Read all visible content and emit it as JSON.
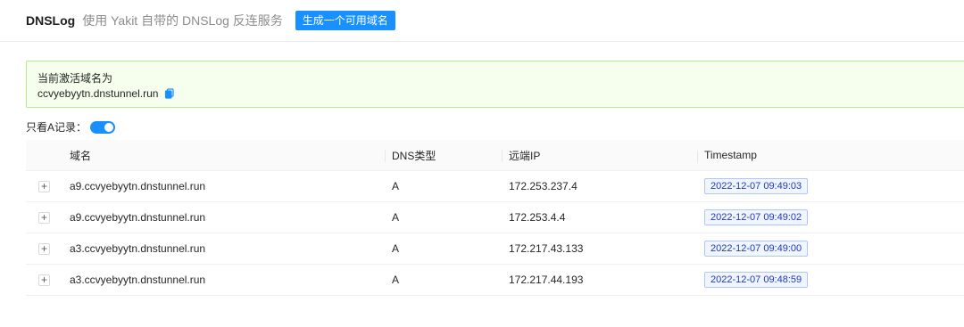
{
  "header": {
    "title": "DNSLog",
    "subtitle": "使用 Yakit 自带的 DNSLog 反连服务",
    "generate_button": "生成一个可用域名"
  },
  "alert": {
    "label": "当前激活域名为",
    "domain": "ccvyebyytn.dnstunnel.run"
  },
  "filter": {
    "label": "只看A记录：",
    "enabled": true
  },
  "table": {
    "columns": [
      "域名",
      "DNS类型",
      "远端IP",
      "Timestamp"
    ],
    "rows": [
      {
        "domain": "a9.ccvyebyytn.dnstunnel.run",
        "type": "A",
        "ip": "172.253.237.4",
        "timestamp": "2022-12-07 09:49:03"
      },
      {
        "domain": "a9.ccvyebyytn.dnstunnel.run",
        "type": "A",
        "ip": "172.253.4.4",
        "timestamp": "2022-12-07 09:49:02"
      },
      {
        "domain": "a3.ccvyebyytn.dnstunnel.run",
        "type": "A",
        "ip": "172.217.43.133",
        "timestamp": "2022-12-07 09:49:00"
      },
      {
        "domain": "a3.ccvyebyytn.dnstunnel.run",
        "type": "A",
        "ip": "172.217.44.193",
        "timestamp": "2022-12-07 09:48:59"
      }
    ],
    "expand_symbol": "+"
  },
  "colors": {
    "accent": "#1890ff",
    "alert_bg": "#f6ffed",
    "alert_border": "#b7eb8f",
    "tag_text": "#1d39c4",
    "tag_bg": "#f0f5ff",
    "tag_border": "#adc6ff"
  },
  "icons": {
    "copy": "copy-icon",
    "expand": "plus-square-icon"
  }
}
